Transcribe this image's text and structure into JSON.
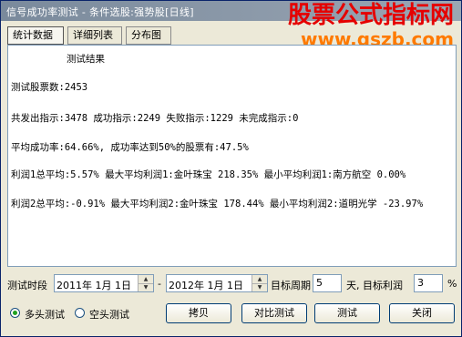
{
  "window": {
    "title": "信号成功率测试 - 条件选股:强势股[日线]"
  },
  "watermark": {
    "line1": "股票公式指标网",
    "line2": "www.gszb.com"
  },
  "tabs": [
    {
      "label": "统计数据"
    },
    {
      "label": "详细列表"
    },
    {
      "label": "分布图"
    }
  ],
  "results": {
    "heading": "测试结果",
    "stock_count": "测试股票数:2453",
    "signals": "共发出指示:3478 成功指示:2249 失败指示:1229 未完成指示:0",
    "avg_rate": "平均成功率:64.66%, 成功率达到50%的股票有:47.5%",
    "profit1": "利润1总平均:5.57% 最大平均利润1:金叶珠宝 218.35% 最小平均利润1:南方航空 0.00%",
    "profit2": "利润2总平均:-0.91% 最大平均利润2:金叶珠宝 178.44% 最小平均利润2:道明光学 -23.97%"
  },
  "period": {
    "label": "测试时段",
    "start": "2011年  1月  1日",
    "separator": "-",
    "end": "2012年  1月  1日",
    "target_label": "目标周期",
    "target_value": "5",
    "unit_label": "天, 目标利润",
    "profit_value": "3",
    "percent": "%"
  },
  "mode": {
    "long_label": "多头测试",
    "short_label": "空头测试",
    "selected": "long"
  },
  "buttons": {
    "copy": "拷贝",
    "compare": "对比测试",
    "test": "测试",
    "close": "关闭"
  }
}
